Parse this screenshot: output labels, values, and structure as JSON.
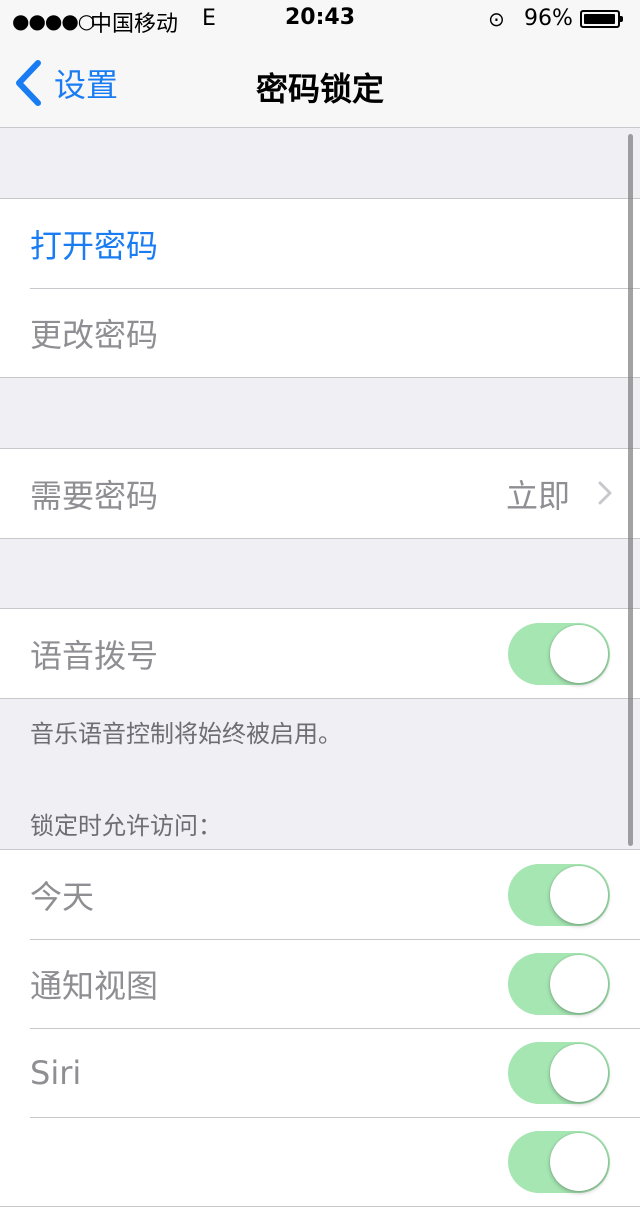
{
  "status_bar": {
    "signal": "●●●●○",
    "carrier": "中国移动",
    "network": "E",
    "time": "20:43",
    "lock_glyph": "⊙",
    "battery_percent": "96%",
    "battery_level": 0.96
  },
  "nav": {
    "back_label": "设置",
    "title": "密码锁定"
  },
  "groups": {
    "passcode": {
      "turn_on": "打开密码",
      "change": "更改密码"
    },
    "require": {
      "label": "需要密码",
      "value": "立即"
    },
    "voice": {
      "label": "语音拨号",
      "on": true,
      "footnote": "音乐语音控制将始终被启用。"
    },
    "locked_access": {
      "header": "锁定时允许访问：",
      "items": [
        {
          "label": "今天",
          "on": true
        },
        {
          "label": "通知视图",
          "on": true
        },
        {
          "label": "Siri",
          "on": true
        }
      ]
    }
  },
  "colors": {
    "accent": "#1a7cf2",
    "toggle_on": "#a5e6b2",
    "background": "#efeff4"
  }
}
